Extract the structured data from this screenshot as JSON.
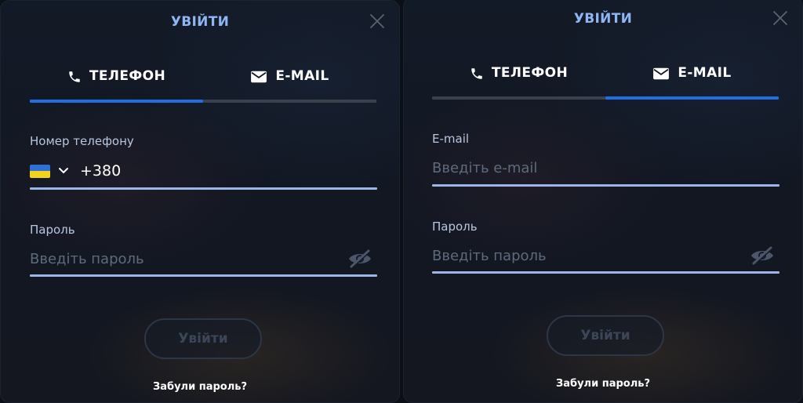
{
  "left_panel": {
    "title": "УВІЙТИ",
    "tabs": [
      {
        "label": "ТЕЛЕФОН",
        "icon": "phone-icon",
        "active": true
      },
      {
        "label": "E-MAIL",
        "icon": "envelope-icon",
        "active": false
      }
    ],
    "phone_label": "Номер телефону",
    "country_flag": "ukraine-flag-icon",
    "phone_prefix": "+380",
    "password_label": "Пароль",
    "password_placeholder": "Введіть пароль",
    "login_label": "Увійти",
    "forgot_label": "Забули пароль?"
  },
  "right_panel": {
    "title": "УВІЙТИ",
    "tabs": [
      {
        "label": "ТЕЛЕФОН",
        "icon": "phone-icon",
        "active": false
      },
      {
        "label": "E-MAIL",
        "icon": "envelope-icon",
        "active": true
      }
    ],
    "email_label": "E-mail",
    "email_placeholder": "Введіть e-mail",
    "password_label": "Пароль",
    "password_placeholder": "Введіть пароль",
    "login_label": "Увійти",
    "forgot_label": "Забули пароль?"
  },
  "colors": {
    "accent": "#1f6fe0",
    "title": "#8fb5f2",
    "field_line": "#9bb6e6",
    "background": "#131a27"
  }
}
